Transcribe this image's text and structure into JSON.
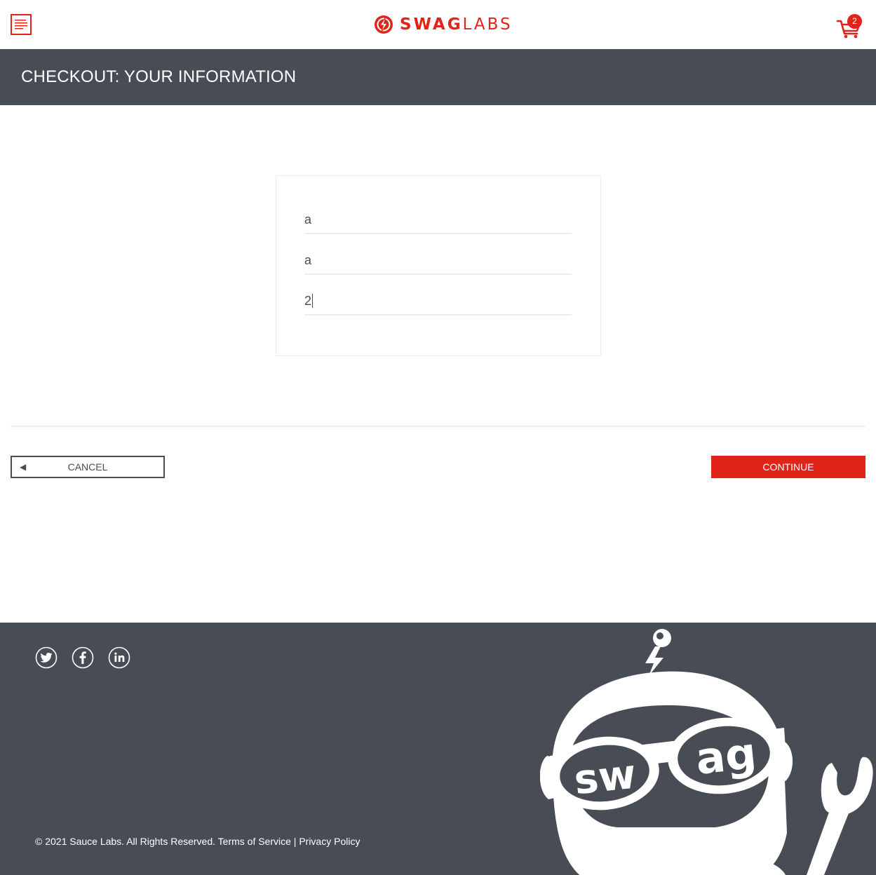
{
  "header": {
    "logo": {
      "bold": "SWAG",
      "light": "LABS"
    },
    "cart_count": "2",
    "brand_color": "#e2231a"
  },
  "subheader": {
    "title": "CHECKOUT: YOUR INFORMATION"
  },
  "form": {
    "first_name": "a",
    "last_name": "a",
    "postal_code": "2"
  },
  "actions": {
    "cancel_arrow": "◀",
    "cancel_label": "CANCEL",
    "continue_label": "CONTINUE"
  },
  "footer": {
    "social": [
      "twitter-icon",
      "facebook-icon",
      "linkedin-icon"
    ],
    "copyright": "© 2021 Sauce Labs. All Rights Reserved. Terms of Service | Privacy Policy",
    "mascot_text": {
      "left": "sw",
      "right": "ag"
    },
    "background": "#474c55"
  }
}
